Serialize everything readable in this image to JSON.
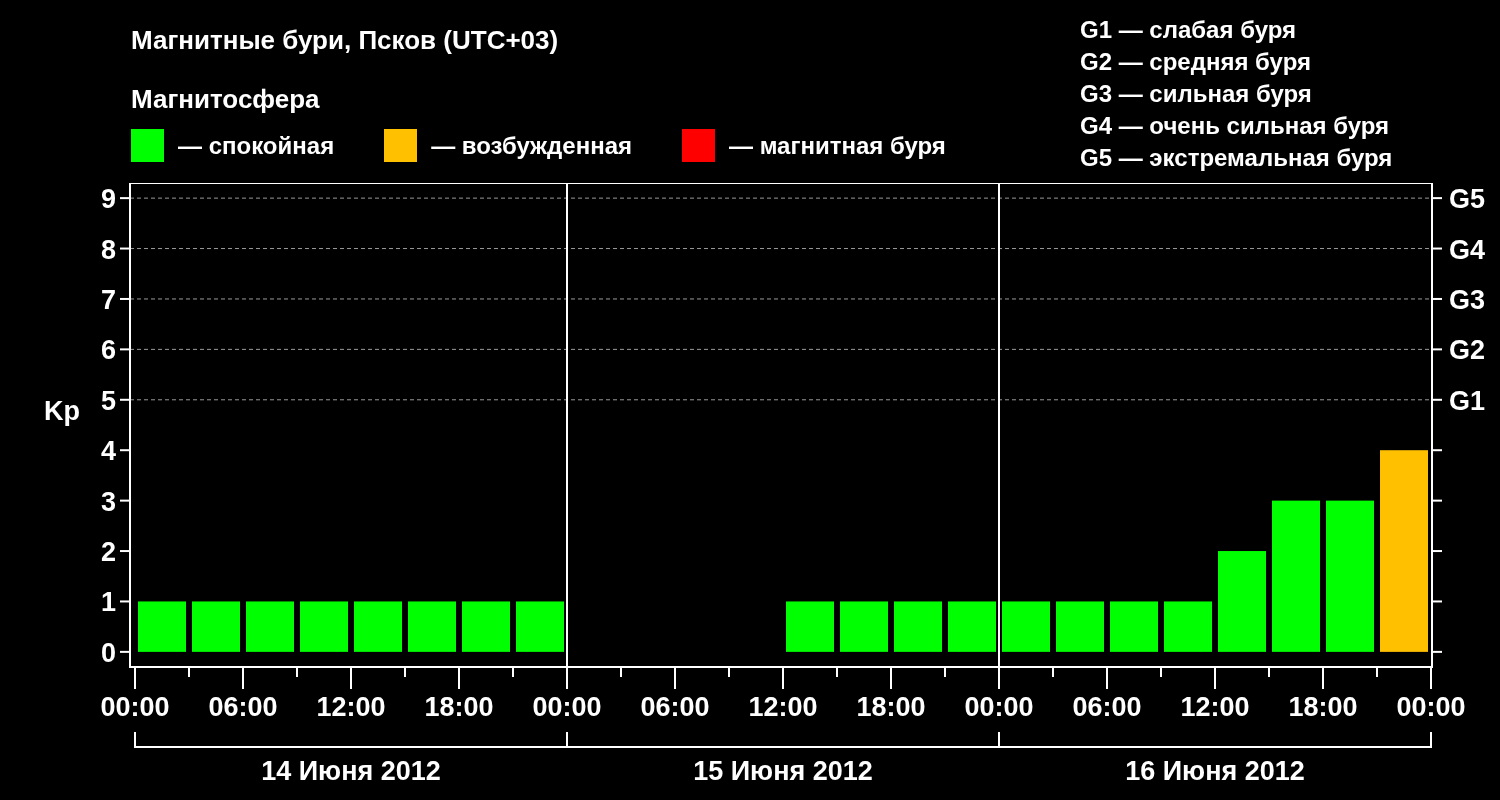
{
  "title": "Магнитные бури, Псков (UTC+03)",
  "magnetosphere": {
    "heading": "Магнитосфера",
    "legend": [
      {
        "label": "— спокойная",
        "color": "#00ff00"
      },
      {
        "label": "— возбужденная",
        "color": "#ffc000"
      },
      {
        "label": "— магнитная буря",
        "color": "#ff0000"
      }
    ]
  },
  "storm_scale": [
    "G1 — слабая буря",
    "G2 — средняя буря",
    "G3 — сильная буря",
    "G4 — очень сильная буря",
    "G5 — экстремальная буря"
  ],
  "chart": {
    "chart_data": {
      "type": "bar",
      "ylabel": "Kp",
      "grid": true,
      "categories": [
        null,
        null,
        null,
        null,
        null,
        null,
        null,
        null,
        null,
        null,
        null,
        null,
        null,
        null,
        null,
        null,
        null,
        null,
        null,
        null,
        null,
        null,
        null,
        null
      ],
      "series": [
        {
          "color": "#00ff00",
          "values": [
            1,
            1,
            1,
            1,
            1,
            1,
            1,
            1,
            0,
            0,
            0,
            0,
            1,
            1,
            1,
            1,
            1,
            1,
            1,
            1,
            2,
            3,
            3,
            null
          ]
        },
        {
          "color": "#ffc000",
          "values": [
            null,
            null,
            null,
            null,
            null,
            null,
            null,
            null,
            null,
            null,
            null,
            null,
            null,
            null,
            null,
            null,
            null,
            null,
            null,
            null,
            null,
            null,
            null,
            4
          ]
        }
      ],
      "ylim": [
        -0.3,
        9.3
      ],
      "yticks": [
        0,
        1,
        2,
        3,
        4,
        5,
        6,
        7,
        8,
        9
      ]
    },
    "time_labels": [
      "00:00",
      "06:00",
      "12:00",
      "18:00",
      "00:00",
      "06:00",
      "12:00",
      "18:00",
      "00:00",
      "06:00",
      "12:00",
      "18:00",
      "00:00"
    ],
    "storm_levels": [
      "G5",
      "G4",
      "G3",
      "G2",
      "G1"
    ],
    "day_labels": [
      "14 Июня 2012",
      "15 Июня 2012",
      "16 Июня 2012"
    ]
  }
}
